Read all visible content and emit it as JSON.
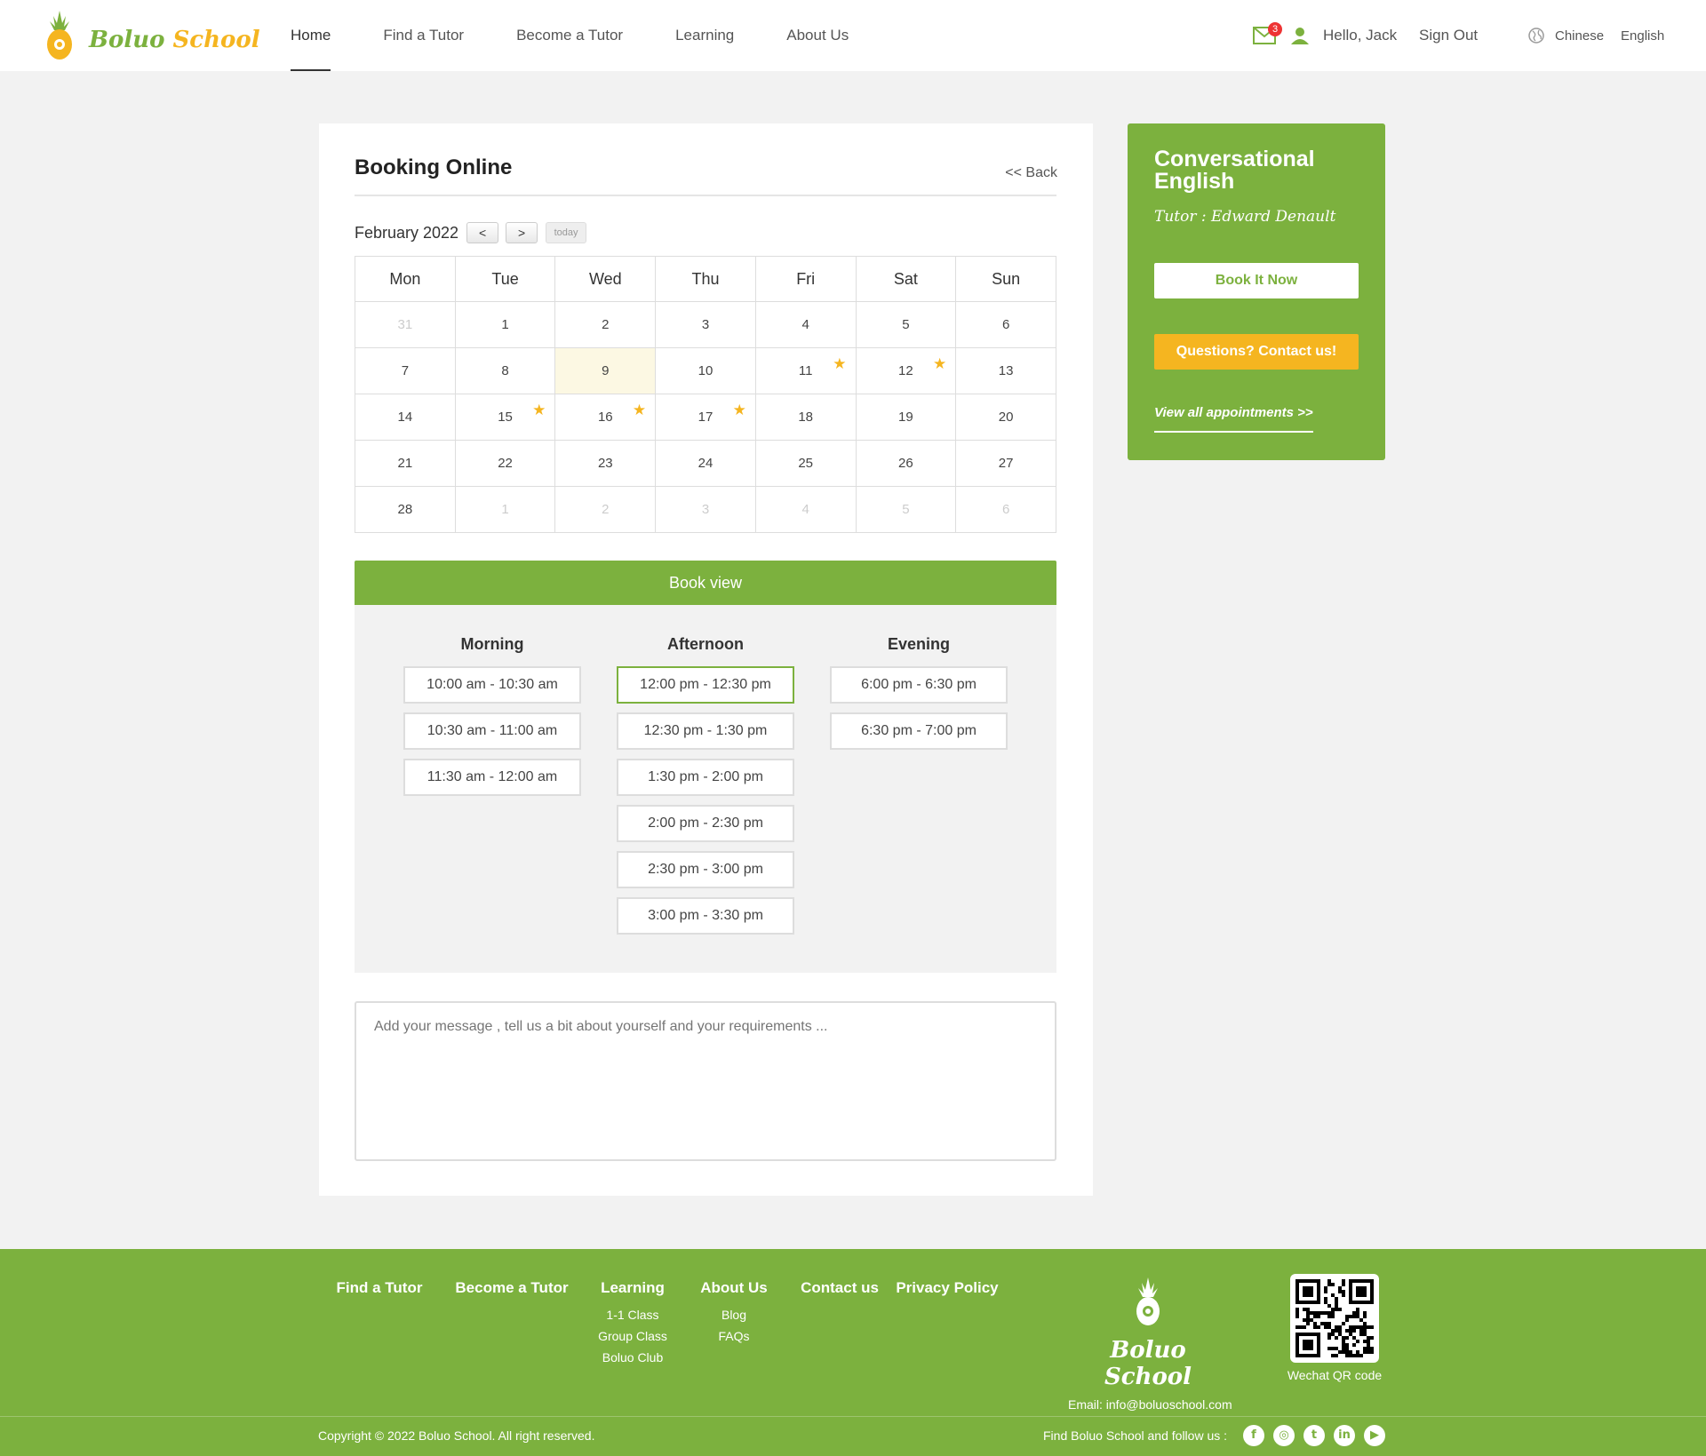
{
  "header": {
    "logo_word1": "Boluo",
    "logo_word2": "School",
    "nav": [
      "Home",
      "Find a Tutor",
      "Become a Tutor",
      "Learning",
      "About Us"
    ],
    "active_nav": "Home",
    "mail_count": "3",
    "greeting": "Hello, Jack",
    "sign_out": "Sign Out",
    "lang_chinese": "Chinese",
    "lang_english": "English"
  },
  "booking": {
    "title": "Booking Online",
    "back": "<< Back",
    "month": "February 2022",
    "prev": "<",
    "next": ">",
    "today": "today",
    "weekdays": [
      "Mon",
      "Tue",
      "Wed",
      "Thu",
      "Fri",
      "Sat",
      "Sun"
    ],
    "weeks": [
      [
        {
          "d": "31",
          "other": true
        },
        {
          "d": "1"
        },
        {
          "d": "2"
        },
        {
          "d": "3"
        },
        {
          "d": "4"
        },
        {
          "d": "5"
        },
        {
          "d": "6"
        }
      ],
      [
        {
          "d": "7"
        },
        {
          "d": "8"
        },
        {
          "d": "9",
          "today": true
        },
        {
          "d": "10"
        },
        {
          "d": "11",
          "star": true
        },
        {
          "d": "12",
          "star": true
        },
        {
          "d": "13"
        }
      ],
      [
        {
          "d": "14"
        },
        {
          "d": "15",
          "star": true
        },
        {
          "d": "16",
          "star": true
        },
        {
          "d": "17",
          "star": true
        },
        {
          "d": "18"
        },
        {
          "d": "19"
        },
        {
          "d": "20"
        }
      ],
      [
        {
          "d": "21"
        },
        {
          "d": "22"
        },
        {
          "d": "23"
        },
        {
          "d": "24"
        },
        {
          "d": "25"
        },
        {
          "d": "26"
        },
        {
          "d": "27"
        }
      ],
      [
        {
          "d": "28"
        },
        {
          "d": "1",
          "other": true
        },
        {
          "d": "2",
          "other": true
        },
        {
          "d": "3",
          "other": true
        },
        {
          "d": "4",
          "other": true
        },
        {
          "d": "5",
          "other": true
        },
        {
          "d": "6",
          "other": true
        }
      ]
    ],
    "book_view": "Book view",
    "columns": [
      {
        "label": "Morning",
        "slots": [
          "10:00 am - 10:30 am",
          "10:30 am - 11:00 am",
          "11:30 am - 12:00 am"
        ]
      },
      {
        "label": "Afternoon",
        "slots": [
          "12:00 pm - 12:30 pm",
          "12:30 pm - 1:30 pm",
          "1:30 pm - 2:00 pm",
          "2:00 pm - 2:30 pm",
          "2:30 pm - 3:00 pm",
          "3:00 pm - 3:30 pm"
        ],
        "selected": "12:00 pm - 12:30 pm"
      },
      {
        "label": "Evening",
        "slots": [
          "6:00 pm - 6:30 pm",
          "6:30 pm - 7:00 pm"
        ]
      }
    ],
    "message_placeholder": "Add your message , tell us a bit about yourself and your requirements ..."
  },
  "side": {
    "title": "Conversational English",
    "tutor": "Tutor : Edward Denault",
    "book_now": "Book It Now",
    "questions": "Questions? Contact us!",
    "view_all": "View all appointments >>"
  },
  "footer": {
    "columns": [
      {
        "heading": "Find a Tutor",
        "items": []
      },
      {
        "heading": "Become a Tutor",
        "items": []
      },
      {
        "heading": "Learning",
        "items": [
          "1-1 Class",
          "Group Class",
          "Boluo Club"
        ]
      },
      {
        "heading": "About Us",
        "items": [
          "Blog",
          "FAQs"
        ]
      },
      {
        "heading": "Contact us",
        "items": []
      },
      {
        "heading": "Privacy Policy",
        "items": []
      }
    ],
    "logo_text": "Boluo School",
    "email": "Email: info@boluoschool.com",
    "qr_label": "Wechat QR code",
    "copyright": "Copyright © 2022  Boluo School.    All right reserved.",
    "follow": "Find Boluo School and follow us :",
    "social": [
      "facebook-icon",
      "instagram-icon",
      "twitter-icon",
      "linkedin-icon",
      "youtube-icon"
    ]
  },
  "colors": {
    "brand_green": "#7cb13e",
    "brand_yellow": "#f5b520"
  }
}
